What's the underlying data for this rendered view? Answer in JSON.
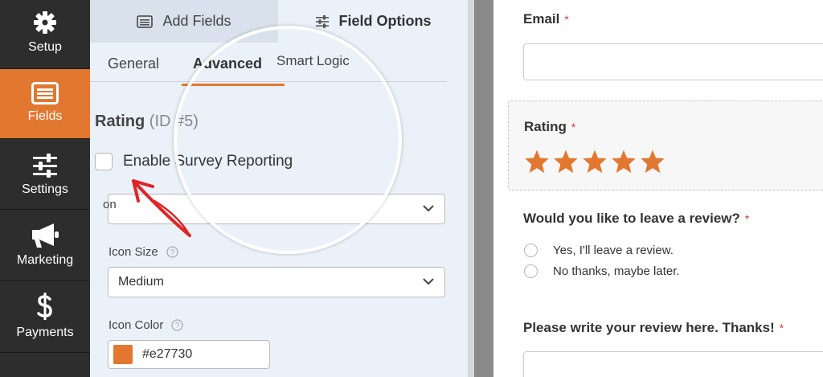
{
  "nav": {
    "items": [
      {
        "label": "Setup",
        "icon": "gear-icon"
      },
      {
        "label": "Fields",
        "icon": "fields-list-icon",
        "active": true
      },
      {
        "label": "Settings",
        "icon": "sliders-icon"
      },
      {
        "label": "Marketing",
        "icon": "megaphone-icon"
      },
      {
        "label": "Payments",
        "icon": "dollar-icon"
      }
    ]
  },
  "panel": {
    "tabs": {
      "add_fields": "Add Fields",
      "field_options": "Field Options"
    },
    "subtabs": {
      "general": "General",
      "advanced": "Advanced",
      "smart_logic": "Smart Logic"
    },
    "field": {
      "name": "Rating",
      "id": "(ID #5)"
    },
    "survey_label": "Enable Survey Reporting",
    "icon_label_partial": "on",
    "icon_size_label": "Icon Size",
    "icon_size_value": "Medium",
    "icon_color_label": "Icon Color",
    "icon_color_value": "#e27730"
  },
  "preview": {
    "email_label": "Email",
    "rating_label": "Rating",
    "rating_stars": 5,
    "review_question": "Would you like to leave a review?",
    "review_options": [
      "Yes, I'll leave a review.",
      "No thanks, maybe later."
    ],
    "write_review_label": "Please write your review here. Thanks!",
    "required_mark": "*"
  },
  "colors": {
    "accent": "#e27730",
    "nav_bg": "#2d2d2d",
    "panel_bg": "#eaf1f9",
    "required": "#d63638"
  }
}
